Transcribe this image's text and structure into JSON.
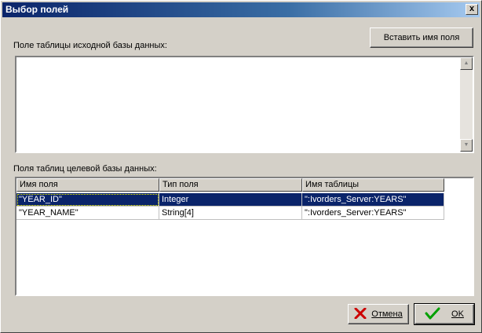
{
  "window": {
    "title": "Выбор полей"
  },
  "close_glyph": "x",
  "insert_button": {
    "label": "Вставить имя поля"
  },
  "source_field": {
    "label": "Поле таблицы исходной базы данных:",
    "value": ""
  },
  "target_grid": {
    "label": "Поля таблиц целевой базы данных:",
    "columns": [
      "Имя поля",
      "Тип поля",
      "Имя таблицы"
    ],
    "rows": [
      {
        "name": "\"YEAR_ID\"",
        "type": "Integer",
        "table": "\":Ivorders_Server:YEARS\"",
        "selected": true
      },
      {
        "name": "\"YEAR_NAME\"",
        "type": "String[4]",
        "table": "\":Ivorders_Server:YEARS\"",
        "selected": false
      }
    ]
  },
  "cancel_button": {
    "label": "Отмена",
    "icon": "red-x-icon",
    "icon_color": "#cc0000"
  },
  "ok_button": {
    "label": "OK",
    "icon": "green-check-icon",
    "icon_color": "#00a000"
  },
  "colors": {
    "titlebar": "#0a246a",
    "selection": "#0a246a",
    "face": "#d4d0c8"
  }
}
